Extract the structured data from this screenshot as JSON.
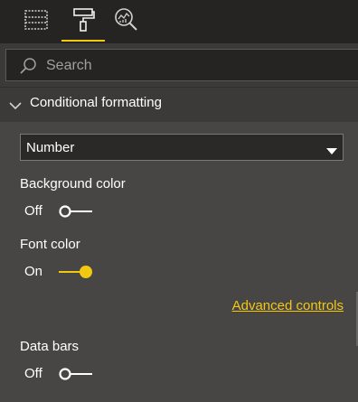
{
  "colors": {
    "accent": "#f2c811",
    "background": "#3b3a39",
    "panel": "#484644",
    "toolbar": "#252423"
  },
  "toolbar": {
    "tabs": [
      {
        "icon": "fields-icon",
        "active": false
      },
      {
        "icon": "format-paint-roller-icon",
        "active": true
      },
      {
        "icon": "analytics-icon",
        "active": false
      }
    ]
  },
  "search": {
    "placeholder": "Search",
    "value": ""
  },
  "section": {
    "title": "Conditional formatting",
    "expanded": true
  },
  "dropdown": {
    "selected": "Number"
  },
  "settings": {
    "background_color": {
      "label": "Background color",
      "state": "Off",
      "on": false
    },
    "font_color": {
      "label": "Font color",
      "state": "On",
      "on": true
    },
    "advanced_controls": "Advanced controls",
    "data_bars": {
      "label": "Data bars",
      "state": "Off",
      "on": false
    }
  }
}
